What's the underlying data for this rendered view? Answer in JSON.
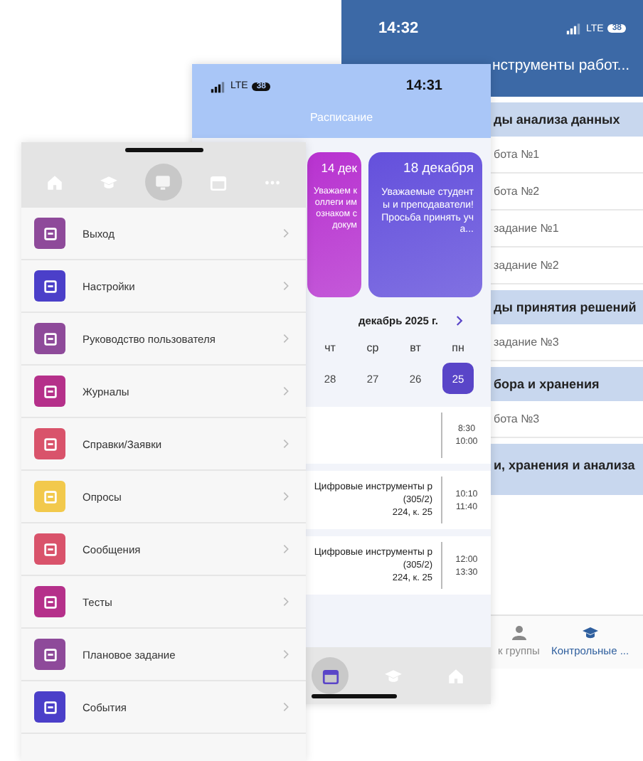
{
  "menu_screen": {
    "tabs": [
      {
        "selected": false
      },
      {
        "selected": false
      },
      {
        "selected": true
      },
      {
        "selected": false
      },
      {
        "selected": false
      }
    ],
    "items": [
      {
        "label": "Выход",
        "color": "#8e4a9a"
      },
      {
        "label": "Настройки",
        "color": "#4b3fc9"
      },
      {
        "label": "Руководство пользователя",
        "color": "#8e4a9a"
      },
      {
        "label": "Журналы",
        "color": "#b5308a"
      },
      {
        "label": "Справки/Заявки",
        "color": "#d9536b"
      },
      {
        "label": "Опросы",
        "color": "#f2c94c"
      },
      {
        "label": "Сообщения",
        "color": "#d9536b"
      },
      {
        "label": "Тесты",
        "color": "#b5308a"
      },
      {
        "label": "Плановое задание",
        "color": "#8e4a9a"
      },
      {
        "label": "События",
        "color": "#4b3fc9"
      }
    ]
  },
  "schedule_screen": {
    "status_bar": {
      "time": "14:31",
      "network": "LTE",
      "battery": "38"
    },
    "title": "Расписание",
    "cards": [
      {
        "date": "14 дек",
        "text": "Уважаем коллеги им ознаком с докум",
        "color": "#b832d0"
      },
      {
        "date": "18 декабря",
        "text": "Уважаемые студенты и преподаватели! Просьба принять уча...",
        "color": "#6450dc"
      }
    ],
    "month": "декабрь 2025 г.",
    "days": [
      {
        "weekday": "чт",
        "date": "28",
        "selected": false
      },
      {
        "weekday": "ср",
        "date": "27",
        "selected": false
      },
      {
        "weekday": "вт",
        "date": "26",
        "selected": false
      },
      {
        "weekday": "пн",
        "date": "25",
        "selected": true
      }
    ],
    "lessons": [
      {
        "start": "8:30",
        "end": "10:00"
      },
      {
        "start": "10:10",
        "end": "11:40",
        "subject": "Цифровые инструменты р",
        "group": "(305/2)",
        "room": "224, к. 25"
      },
      {
        "start": "12:00",
        "end": "13:30",
        "subject": "Цифровые инструменты р",
        "group": "(305/2)",
        "room": "224, к. 25"
      }
    ],
    "tabs": [
      {
        "selected": true
      },
      {
        "selected": false
      },
      {
        "selected": false
      }
    ]
  },
  "assignments_screen": {
    "status_bar": {
      "time": "14:32",
      "network": "LTE",
      "battery": "38"
    },
    "title": "нструменты работ...",
    "rows": [
      {
        "kind": "section",
        "text": "ды анализа данных"
      },
      {
        "kind": "item",
        "text": "бота №1"
      },
      {
        "kind": "item",
        "text": "бота №2"
      },
      {
        "kind": "item",
        "text": "задание №1"
      },
      {
        "kind": "item",
        "text": "задание №2"
      },
      {
        "kind": "section",
        "text": "ды принятия решений"
      },
      {
        "kind": "item",
        "text": "задание №3"
      },
      {
        "kind": "section",
        "text": "бора и хранения"
      },
      {
        "kind": "item",
        "text": "бота №3"
      },
      {
        "kind": "section",
        "text": "и, хранения и анализа"
      }
    ],
    "tabs": [
      {
        "label": "к группы",
        "selected": false
      },
      {
        "label": "Контрольные ...",
        "selected": true
      }
    ]
  }
}
